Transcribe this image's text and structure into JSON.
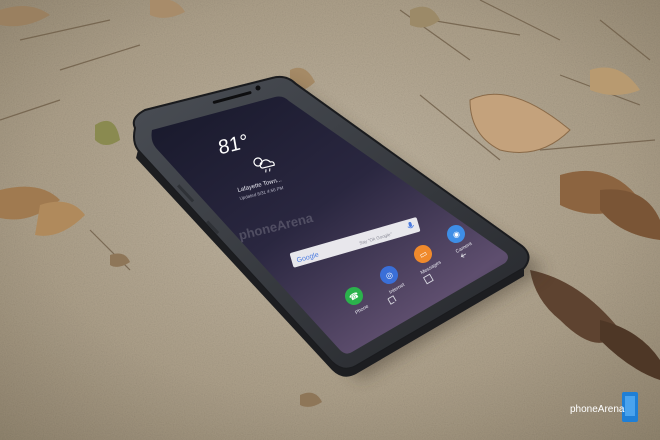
{
  "photo": {
    "brand_watermark": "phoneArena",
    "screen_watermark": "phoneArena"
  },
  "phone": {
    "body_color": "#2a2c30",
    "bumper_color": "#3c4046",
    "screen_top_color": "#1b1c2e",
    "screen_bottom_color": "#6a5a7a"
  },
  "lock_widget": {
    "temperature": "81°",
    "weather_icon": "partly-cloudy-rain-icon",
    "location": "Lafayette Town...",
    "updated": "Updated 8/31 4:56 PM"
  },
  "search_bar": {
    "logo": "Google",
    "hint": "Say \"Ok Google\"",
    "mic_icon": "microphone-icon"
  },
  "dock": [
    {
      "label": "Phone",
      "icon": "phone-icon",
      "color": "#2bb24c"
    },
    {
      "label": "Internet",
      "icon": "internet-planet-icon",
      "color": "#3a6fd8"
    },
    {
      "label": "Messages",
      "icon": "message-bubble-icon",
      "color": "#f08a2c"
    },
    {
      "label": "Camera",
      "icon": "camera-icon",
      "color": "#3e8ee6"
    }
  ],
  "nav_bar": {
    "recents_icon": "recents-icon",
    "home_icon": "home-icon",
    "back_icon": "back-icon"
  },
  "colors": {
    "sand": "#b3a792",
    "sand_dark": "#8f836d",
    "leaf": "#8a6a48"
  }
}
